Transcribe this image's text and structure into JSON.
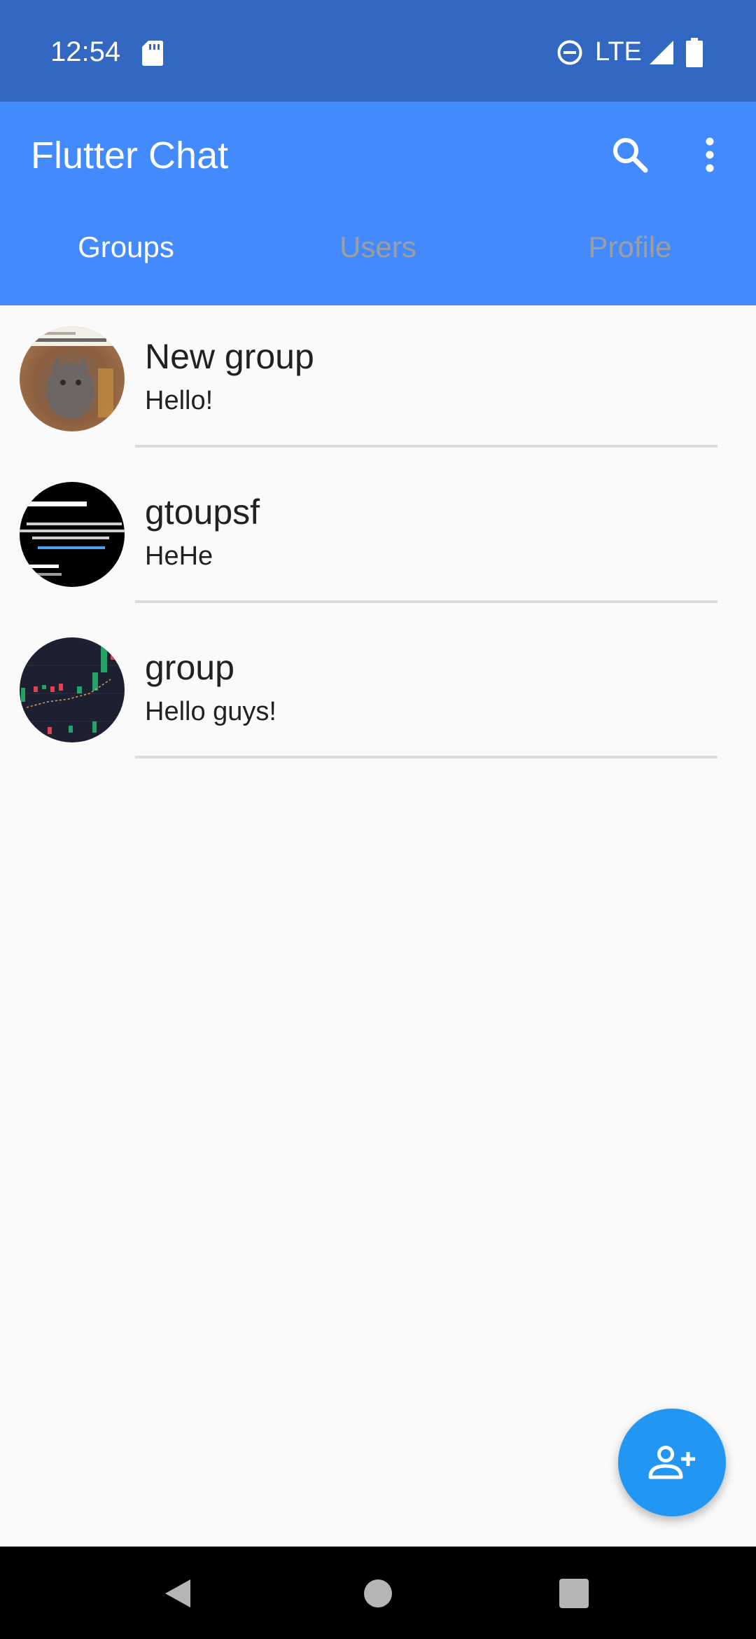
{
  "status_bar": {
    "time": "12:54",
    "network": "LTE",
    "icons": [
      "sd-card-icon",
      "do-not-disturb-icon",
      "signal-icon",
      "battery-icon"
    ]
  },
  "app_bar": {
    "title": "Flutter Chat",
    "actions": [
      "search-icon",
      "more-vert-icon"
    ],
    "color": "#448aff"
  },
  "tabs": [
    {
      "label": "Groups",
      "active": true
    },
    {
      "label": "Users",
      "active": false
    },
    {
      "label": "Profile",
      "active": false
    }
  ],
  "groups": [
    {
      "name": "New group",
      "last_message": "Hello!",
      "avatar": "cat-photo"
    },
    {
      "name": "gtoupsf",
      "last_message": "HeHe",
      "avatar": "message-requests-screenshot"
    },
    {
      "name": "group",
      "last_message": "Hello guys!",
      "avatar": "candlestick-chart-screenshot"
    }
  ],
  "fab": {
    "icon": "add-user-icon",
    "color": "#2196f3"
  },
  "nav_bar": {
    "icons": [
      "back-icon",
      "home-icon",
      "recents-icon"
    ]
  }
}
